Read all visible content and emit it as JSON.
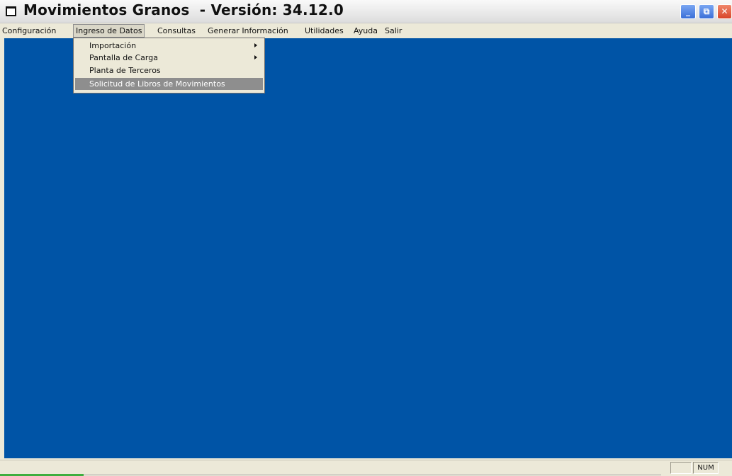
{
  "window": {
    "title": "Movimientos Granos  - Versión: 34.12.0",
    "controls": {
      "minimize": "_",
      "maximize": "⧉",
      "close": "✕"
    }
  },
  "menubar": {
    "items": [
      {
        "label": "Configuración"
      },
      {
        "label": "Ingreso de Datos",
        "active": true
      },
      {
        "label": "Consultas"
      },
      {
        "label": "Generar Información"
      },
      {
        "label": "Utilidades"
      },
      {
        "label": "Ayuda"
      },
      {
        "label": "Salir"
      }
    ]
  },
  "dropdown": {
    "items": [
      {
        "label": "Importación",
        "submenu": true
      },
      {
        "label": "Pantalla de Carga",
        "submenu": true
      },
      {
        "label": "Planta de Terceros",
        "submenu": false
      },
      {
        "label": "Solicitud de Libros de Movimientos",
        "submenu": false,
        "highlighted": true
      }
    ]
  },
  "statusbar": {
    "num_indicator": "NUM"
  },
  "colors": {
    "desktop": "#0054a6",
    "chrome": "#ece9d8",
    "highlight": "#8e8e8e"
  }
}
